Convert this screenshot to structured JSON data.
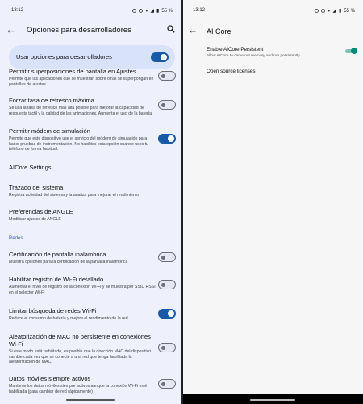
{
  "left": {
    "status": {
      "time": "13:12",
      "battery": "55 %"
    },
    "title": "Opciones para desarrolladores",
    "master_toggle": {
      "label": "Usar opciones para desarrolladores",
      "on": true
    },
    "items": [
      {
        "title": "Permitir superposiciones de pantalla en Ajustes",
        "subtitle": "Permite que las aplicaciones que se muestran sobre otras se superpongan en pantallas de ajustes",
        "toggle": "off"
      },
      {
        "title": "Forzar tasa de refresco máxima",
        "subtitle": "Se usa la tasa de refresco más alta posible para mejorar la capacidad de respuesta táctil y la calidad de las animaciones. Aumenta el uso de la batería.",
        "toggle": "off"
      },
      {
        "title": "Permitir módem de simulación",
        "subtitle": "Permite que este dispositivo use el servicio del módem de simulación para hacer pruebas de instrumentación. No habilites esta opción cuando uses tu teléfono de forma habitual.",
        "toggle": "on"
      },
      {
        "title": "AICore Settings",
        "subtitle": "",
        "toggle": null
      },
      {
        "title": "Trazado del sistema",
        "subtitle": "Registra actividad del sistema y la analiza para mejorar el rendimiento",
        "toggle": null
      },
      {
        "title": "Preferencias de ANGLE",
        "subtitle": "Modificar ajustes de ANGLE",
        "toggle": null
      }
    ],
    "section_label": "Redes",
    "net_items": [
      {
        "title": "Certificación de pantalla inalámbrica",
        "subtitle": "Muestra opciones para la certificación de la pantalla inalámbrica",
        "toggle": "off"
      },
      {
        "title": "Habilitar registro de Wi-Fi detallado",
        "subtitle": "Aumentar el nivel de registro de la conexión Wi-Fi y se muestra por SSID RSSI en el selector Wi-Fi",
        "toggle": "off"
      },
      {
        "title": "Limitar búsqueda de redes Wi-Fi",
        "subtitle": "Reduce el consumo de batería y mejora el rendimiento de la red",
        "toggle": "on"
      },
      {
        "title": "Aleatorización de MAC no persistente en conexiones Wi-Fi",
        "subtitle": "Si este modo está habilitado, es posible que la dirección MAC del dispositivo cambie cada vez que se conecte a una red que tenga habilitada la aleatorización de MAC.",
        "toggle": "off"
      },
      {
        "title": "Datos móviles siempre activos",
        "subtitle": "Mantiene los datos móviles siempre activos aunque la conexión Wi-Fi esté habilitada (para cambiar de red rápidamente)",
        "toggle": "off"
      }
    ]
  },
  "right": {
    "status": {
      "time": "13:12",
      "battery": "55 %"
    },
    "title": "AI Core",
    "setting": {
      "title": "Enable AICore Persistent",
      "subtitle": "Allow AICore to carve out memory and run persistently.",
      "on": true
    },
    "licenses": "Open source licenses"
  }
}
